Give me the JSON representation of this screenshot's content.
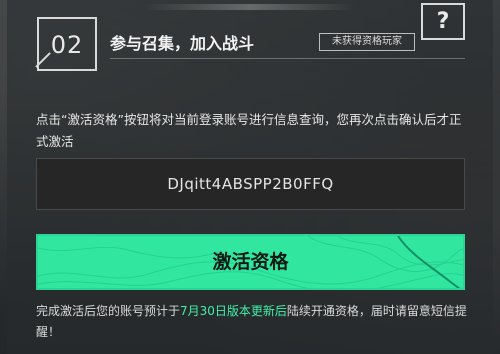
{
  "header": {
    "step_number": "02",
    "title": "参与召集，加入战斗",
    "status_badge": "未获得资格玩家",
    "help_icon": "question-mark-icon",
    "help_label": "?"
  },
  "main": {
    "instructions": "点击“激活资格”按钮将对当前登录账号进行信息查询，您再次点击确认后才正式激活",
    "code": "DJqitt4ABSPP2B0FFQ",
    "activate_label": "激活资格"
  },
  "footer": {
    "part1": "完成激活后您的账号预计于",
    "highlight": "7月30日版本更新后",
    "part2": "陆续开通资格，届时请留意短信提醒！"
  },
  "colors": {
    "accent": "#31e7a0",
    "highlight_text": "#3ff0a8",
    "background": "#2a2d2f"
  }
}
